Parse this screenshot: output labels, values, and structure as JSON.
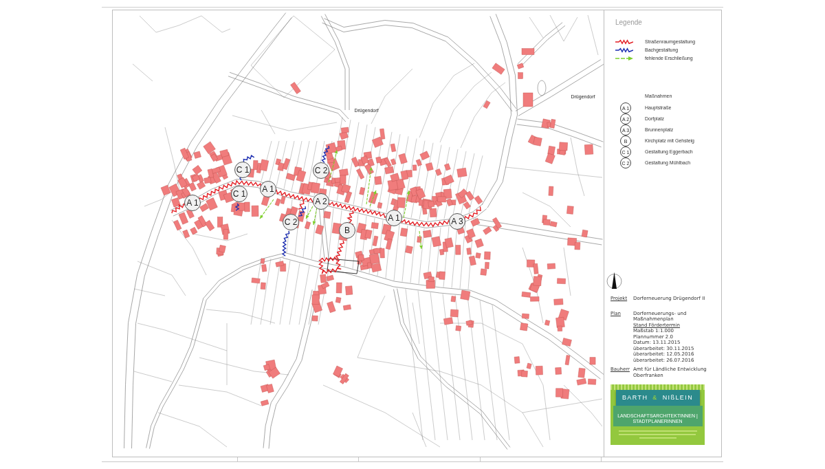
{
  "map": {
    "place_labels": [
      {
        "text": "Drügendorf"
      },
      {
        "text": "Drügendorf"
      }
    ],
    "markers": [
      {
        "code": "A 1"
      },
      {
        "code": "C 1"
      },
      {
        "code": "C 1"
      },
      {
        "code": "A 1"
      },
      {
        "code": "C 2"
      },
      {
        "code": "A 2"
      },
      {
        "code": "C 2"
      },
      {
        "code": "B"
      },
      {
        "code": "A 1"
      },
      {
        "code": "A 3"
      }
    ]
  },
  "legend": {
    "title": "Legende",
    "lines": [
      {
        "kind": "street",
        "label": "Straßenraumgestaltung",
        "color": "#e31e24"
      },
      {
        "kind": "stream",
        "label": "Bachgestaltung",
        "color": "#1b2db0"
      },
      {
        "kind": "access",
        "label": "fehlende Erschließung",
        "color": "#7dcf2c"
      }
    ],
    "measures_title": "Maßnahmen",
    "measures": [
      {
        "code": "A 1",
        "label": "Hauptstraße"
      },
      {
        "code": "A 2",
        "label": "Dorfplatz"
      },
      {
        "code": "A 3",
        "label": "Brunnenplatz"
      },
      {
        "code": "B",
        "label": "Kirchplatz mit Gehsteig"
      },
      {
        "code": "C 1",
        "label": "Gestaltung Eggerbach"
      },
      {
        "code": "C 2",
        "label": "Gestaltung Mühlbach"
      }
    ]
  },
  "title_block": {
    "rows": [
      {
        "label": "Projekt",
        "lines": [
          {
            "text": "Dorferneuerung Drügendorf II",
            "underlined": false
          }
        ]
      },
      {
        "label": "Plan",
        "lines": [
          {
            "text": "Dorferneuerungs- und",
            "underlined": false
          },
          {
            "text": "Maßnahmenplan",
            "underlined": false
          },
          {
            "text": "Stand Fördertermin",
            "underlined": true
          },
          {
            "text": "Maßstab 1:1.000",
            "underlined": false
          },
          {
            "text": "Plannummer 2.0",
            "underlined": false
          },
          {
            "text": "Datum: 13.11.2015",
            "underlined": false
          },
          {
            "text": "überarbeitet: 30.11.2015",
            "underlined": false
          },
          {
            "text": "überarbeitet: 12.05.2016",
            "underlined": false
          },
          {
            "text": "überarbeitet: 26.07.2016",
            "underlined": false
          }
        ]
      },
      {
        "label": "Bauherr",
        "lines": [
          {
            "text": "Amt für Ländliche Entwicklung",
            "underlined": false
          },
          {
            "text": "Oberfranken",
            "underlined": false
          }
        ]
      }
    ]
  },
  "logo": {
    "name_left": "BARTH",
    "name_joiner": "&",
    "name_right": "NIßLEIN",
    "tagline": "LANDSCHAFTSARCHITEKTINNEN | STADTPLANERINNEN"
  }
}
